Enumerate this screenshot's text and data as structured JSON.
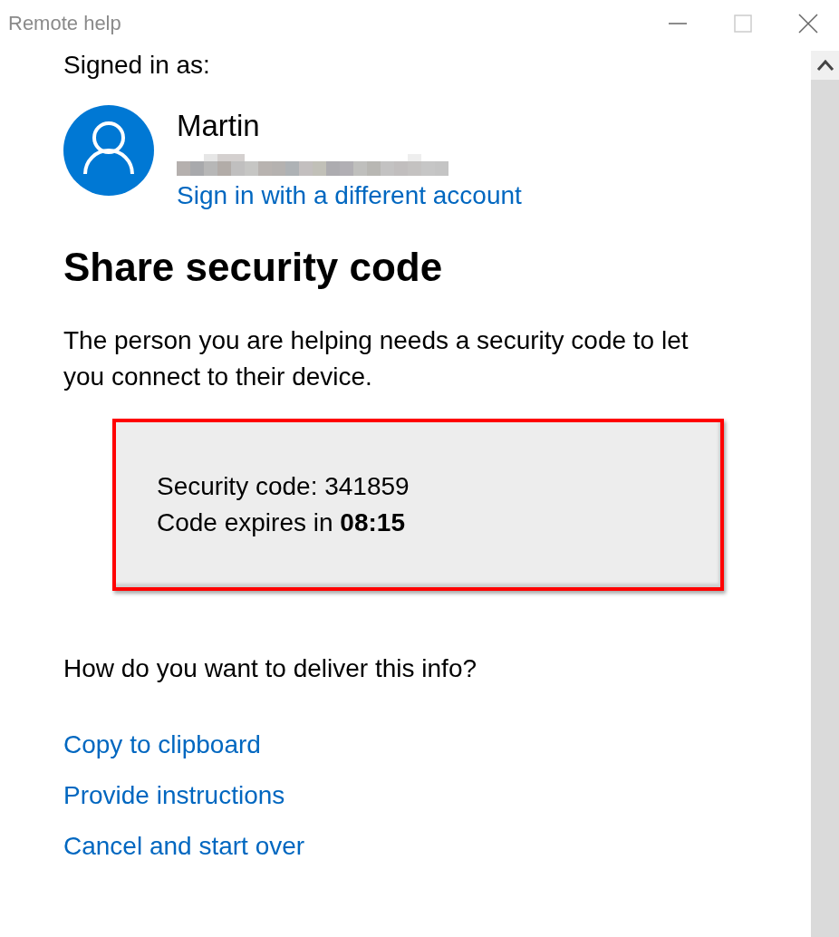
{
  "window": {
    "title": "Remote help"
  },
  "account": {
    "heading": "Signed in as:",
    "name": "Martin",
    "switch_link": "Sign in with a different account"
  },
  "section": {
    "title": "Share security code",
    "description": "The person you are helping needs a security code to let you connect to their device."
  },
  "code_box": {
    "lines": [
      "Security code: 341859",
      "Code expires in **08:15**"
    ]
  },
  "delivery": {
    "question": "How do you want to deliver this info?",
    "links": [
      "Copy to clipboard",
      "Provide instructions",
      "Cancel and start over"
    ]
  }
}
